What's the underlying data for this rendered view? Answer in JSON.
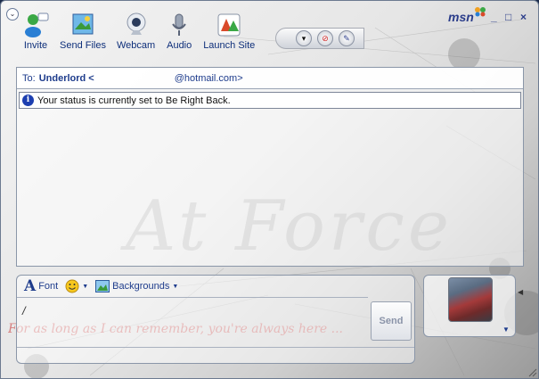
{
  "toolbar": {
    "items": [
      {
        "label": "Invite",
        "icon": "invite-icon"
      },
      {
        "label": "Send Files",
        "icon": "send-files-icon"
      },
      {
        "label": "Webcam",
        "icon": "webcam-icon"
      },
      {
        "label": "Audio",
        "icon": "audio-icon"
      },
      {
        "label": "Launch Site",
        "icon": "launch-site-icon"
      }
    ]
  },
  "brand": {
    "logo": "msn"
  },
  "window_controls": {
    "minimize": "_",
    "maximize": "□",
    "close": "×"
  },
  "conversation": {
    "to_label": "To:",
    "contact_name": "Underlord <",
    "contact_email": "@hotmail.com>",
    "status_message": "Your status is currently set to Be Right Back."
  },
  "format_bar": {
    "font_label": "Font",
    "backgrounds_label": "Backgrounds"
  },
  "input": {
    "value": "/"
  },
  "send_button": {
    "label": "Send"
  },
  "background_art": {
    "watermark": "At Force",
    "script_line": "For as long as I can remember, you're always here ..."
  },
  "colors": {
    "accent": "#1e3c8c",
    "status_icon": "#1d3fb0"
  }
}
